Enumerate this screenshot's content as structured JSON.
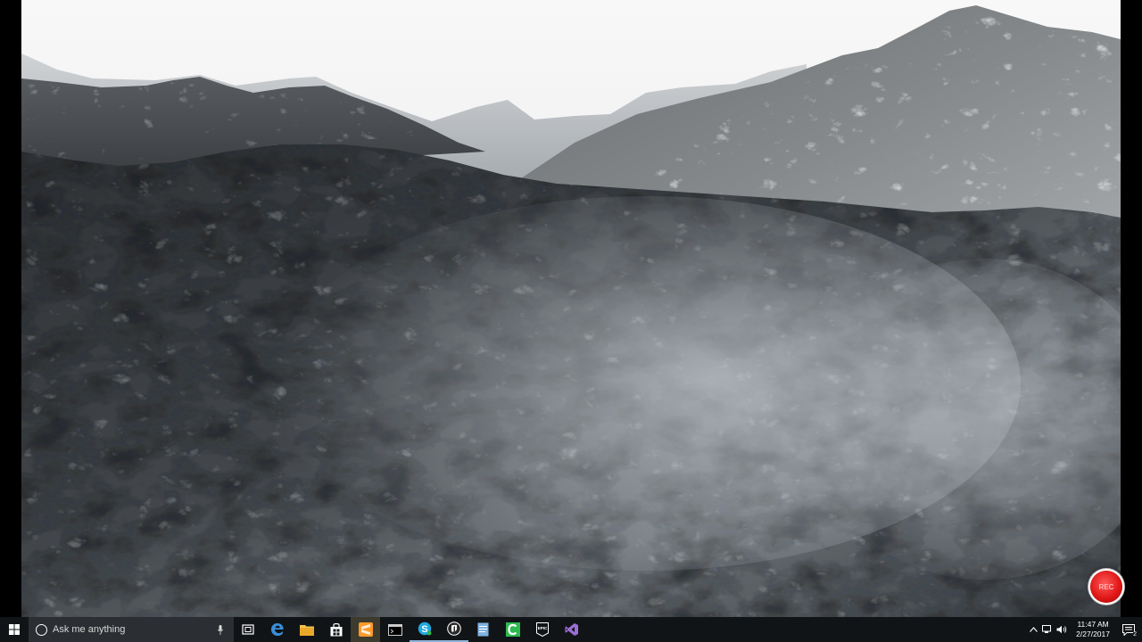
{
  "viewport": {
    "scene": "mountain-terrain-flyover"
  },
  "record_button": {
    "label": "REC",
    "color": "#e01818"
  },
  "taskbar": {
    "search_placeholder": "Ask me anything",
    "apps": [
      {
        "name": "edge-icon",
        "color": "#3b8ed8"
      },
      {
        "name": "file-explorer-icon",
        "color": "#f2c14e"
      },
      {
        "name": "store-icon",
        "color": "#ffffff"
      },
      {
        "name": "sublime-icon",
        "color": "#ff9a2c"
      },
      {
        "name": "terminal-icon",
        "color": "#cccccc"
      },
      {
        "name": "skype-icon",
        "color": "#20a8e0"
      },
      {
        "name": "unreal-engine-icon",
        "color": "#ffffff"
      },
      {
        "name": "notepad-icon",
        "color": "#7fb3e0"
      },
      {
        "name": "camtasia-icon",
        "color": "#2eb84f"
      },
      {
        "name": "epic-games-icon",
        "color": "#ffffff"
      },
      {
        "name": "visual-studio-icon",
        "color": "#9b6fd6"
      }
    ],
    "clock_time": "11:47 AM",
    "clock_date": "2/27/2017",
    "notification_count": "2"
  }
}
